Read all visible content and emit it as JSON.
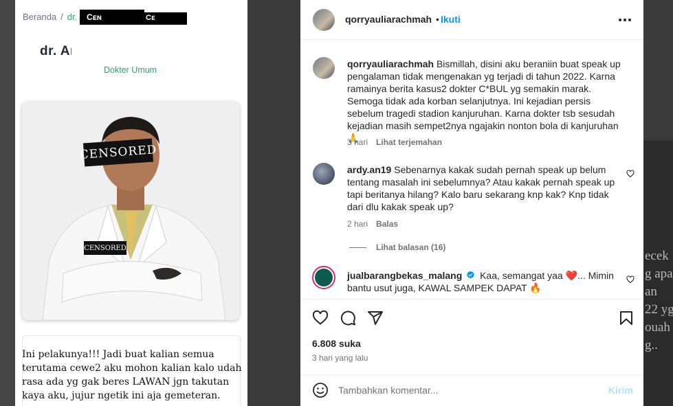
{
  "background": {
    "overlay_text": "ecek\ng apa\nan\n22 yg\nouah\ng.."
  },
  "post_image": {
    "breadcrumb_home": "Beranda",
    "breadcrumb_sep": "/",
    "breadcrumb_current": "dr. A",
    "redaction_labels": [
      "Cᴇɴ",
      "Cᴇ"
    ],
    "doctor_name": "dr. Aı      Y",
    "doctor_role": "Dokter Umum",
    "censor_eyes": "CENSORED",
    "censor_badge": "CENSORED",
    "caption": "Ini pelakunya!!! Jadi buat kalian semua terutama cewe2 aku mohon kalian kalo udah rasa ada yg gak beres LAWAN jgn takutan kaya aku, jujur ngetik ini aja gemeteran."
  },
  "header": {
    "username": "qorryauliarachmah",
    "separator": "•",
    "follow_label": "Ikuti"
  },
  "comments": [
    {
      "username": "qorryauliarachmah",
      "text": "Bismillah, disini aku beraniin buat speak up pengalaman tidak mengenakan yg terjadi di tahun 2022. Karna ramainya berita kasus2 dokter C*BUL yg semakin marak. Semoga tidak ada korban selanjutnya. Ini kejadian persis sebelum tragedi stadion kanjuruhan. Karna dokter tsb sesudah kejadian masih sempet2nya ngajakin nonton bola di kanjuruhan🙏",
      "time": "3 hari",
      "action": "Lihat terjemahan"
    },
    {
      "username": "ardy.an19",
      "text": "Sebenarnya kakak sudah pernah speak up belum tentang masalah ini sebelumnya? Atau kakak pernah speak up tapi beritanya hilang? Kalo baru sekarang knp kak? Knp tidak dari dlu kakak speak up?",
      "time": "2 hari",
      "action": "Balas",
      "replies_label": "Lihat balasan (16)"
    },
    {
      "username": "jualbarangbekas_malang",
      "text": "Kaa, semangat yaa ❤️... Mimin bantu usut juga, KAWAL SAMPEK DAPAT 🔥",
      "verified": true
    }
  ],
  "actions": {
    "likes": "6.808 suka",
    "posted": "3 hari yang lalu"
  },
  "composer": {
    "placeholder": "Tambahkan komentar...",
    "post_label": "Kirim"
  },
  "colors": {
    "link_blue": "#0095f6",
    "green_accent": "#2fa36b",
    "verified_blue": "#0095f6",
    "muted": "#737373"
  },
  "icons": [
    "more-options-icon",
    "heart-icon",
    "comment-icon",
    "share-icon",
    "bookmark-icon",
    "emoji-icon",
    "verified-badge-icon",
    "like-comment-icon"
  ]
}
